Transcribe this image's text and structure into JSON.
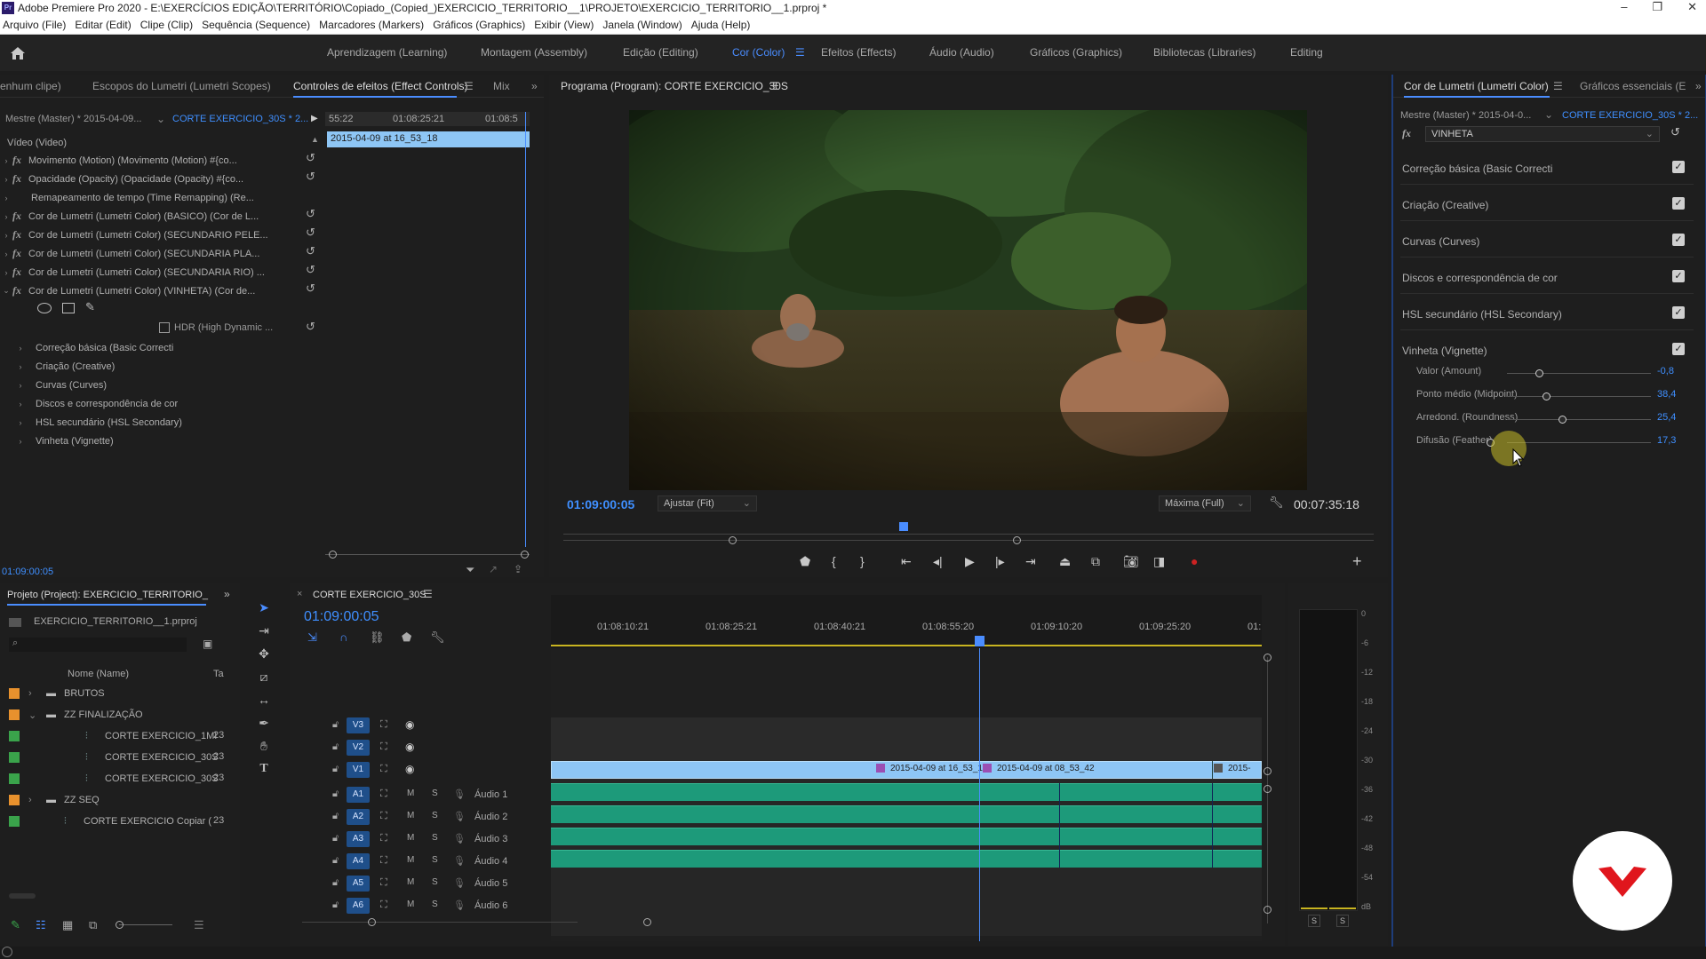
{
  "titlebar": {
    "logo": "Pr",
    "title": "Adobe Premiere Pro 2020 - E:\\EXERCÍCIOS EDIÇÃO\\TERRITÓRIO\\Copiado_(Copied_)EXERCICIO_TERRITORIO__1\\PROJETO\\EXERCICIO_TERRITORIO__1.prproj *",
    "minimize": "–",
    "maximize": "❐",
    "close": "✕"
  },
  "menu": [
    "Arquivo (File)",
    "Editar (Edit)",
    "Clipe (Clip)",
    "Sequência (Sequence)",
    "Marcadores (Markers)",
    "Gráficos (Graphics)",
    "Exibir (View)",
    "Janela (Window)",
    "Ajuda (Help)"
  ],
  "workspaces": {
    "tabs": [
      "Aprendizagem (Learning)",
      "Montagem (Assembly)",
      "Edição (Editing)",
      "Cor (Color)",
      "Efeitos (Effects)",
      "Áudio (Audio)",
      "Gráficos (Graphics)",
      "Bibliotecas (Libraries)",
      "Editing"
    ],
    "active": "Cor (Color)"
  },
  "source_panel": {
    "tabs": [
      "enhum clipe)",
      "Escopos do Lumetri (Lumetri Scopes)",
      "Controles de efeitos (Effect Controls)",
      "Mix"
    ],
    "master_label": "Mestre (Master) * 2015-04-09...",
    "sequence_label": "CORTE EXERCICIO_30S * 2...",
    "ruler": [
      "55:22",
      "01:08:25:21",
      "01:08:5"
    ],
    "clip_name": "2015-04-09 at 16_53_18",
    "video_header": "Vídeo (Video)",
    "effects": [
      "Movimento (Motion)  (Movimento (Motion) #{co...",
      "Opacidade (Opacity)  (Opacidade (Opacity) #{co...",
      "Remapeamento de tempo (Time Remapping)  (Re...",
      "Cor de Lumetri (Lumetri Color) (BASICO)  (Cor de L...",
      "Cor de Lumetri (Lumetri Color) (SECUNDARIO PELE...",
      "Cor de Lumetri (Lumetri Color) (SECUNDARIA PLA...",
      "Cor de Lumetri (Lumetri Color) (SECUNDARIA RIO) ...",
      "Cor de Lumetri (Lumetri Color) (VINHETA)  (Cor de..."
    ],
    "hdr_label": "HDR (High Dynamic ...",
    "sub_sections": [
      "Correção básica (Basic Correcti",
      "Criação (Creative)",
      "Curvas (Curves)",
      "Discos e correspondência de cor",
      "HSL secundário (HSL Secondary)",
      "Vinheta (Vignette)"
    ],
    "timecode": "01:09:00:05"
  },
  "program_monitor": {
    "title": "Programa (Program): CORTE EXERCICIO_30S",
    "timecode": "01:09:00:05",
    "fit": "Ajustar (Fit)",
    "quality": "Máxima (Full)",
    "duration": "00:07:35:18"
  },
  "lumetri": {
    "tabs": [
      "Cor de Lumetri (Lumetri Color)",
      "Gráficos essenciais (E"
    ],
    "master_label": "Mestre (Master) * 2015-04-0...",
    "sequence_label": "CORTE EXERCICIO_30S * 2...",
    "effect_select": "VINHETA",
    "sections": [
      "Correção básica (Basic Correcti",
      "Criação (Creative)",
      "Curvas (Curves)",
      "Discos e correspondência de cor",
      "HSL secundário (HSL Secondary)",
      "Vinheta (Vignette)"
    ],
    "sliders": [
      {
        "label": "Valor (Amount)",
        "value": "-0,8",
        "fraction": 0.52
      },
      {
        "label": "Ponto médio (Midpoint)",
        "value": "38,4",
        "fraction": 0.55
      },
      {
        "label": "Arredond. (Roundness)",
        "value": "25,4",
        "fraction": 0.62
      },
      {
        "label": "Difusão (Feather)",
        "value": "17,3",
        "fraction": 0.31
      }
    ]
  },
  "project": {
    "title": "Projeto (Project): EXERCICIO_TERRITORIO_",
    "file": "EXERCICIO_TERRITORIO__1.prproj",
    "column_name": "Nome (Name)",
    "column_rate": "Ta",
    "items": [
      {
        "name": "BRUTOS",
        "type": "bin",
        "color": "#e8912d",
        "count": ""
      },
      {
        "name": "ZZ FINALIZAÇÃO",
        "type": "bin",
        "color": "#e8912d",
        "count": ""
      },
      {
        "name": "CORTE EXERCICIO_1MI",
        "type": "seq",
        "color": "#3aa34b",
        "count": "23"
      },
      {
        "name": "CORTE EXERCICIO_30S",
        "type": "seq",
        "color": "#3aa34b",
        "count": "23"
      },
      {
        "name": "CORTE EXERCICIO_30S",
        "type": "seq",
        "color": "#3aa34b",
        "count": "23"
      },
      {
        "name": "ZZ SEQ",
        "type": "bin",
        "color": "#e8912d",
        "count": ""
      },
      {
        "name": "CORTE EXERCICIO Copiar (",
        "type": "seq",
        "color": "#3aa34b",
        "count": "23"
      }
    ]
  },
  "timeline": {
    "sequence_tab": "CORTE EXERCICIO_30S",
    "timecode": "01:09:00:05",
    "ruler": [
      "01:08:10:21",
      "01:08:25:21",
      "01:08:40:21",
      "01:08:55:20",
      "01:09:10:20",
      "01:09:25:20",
      "01:"
    ],
    "video_tracks": [
      "V3",
      "V2",
      "V1"
    ],
    "audio_tracks": [
      {
        "id": "A1",
        "name": "Áudio 1"
      },
      {
        "id": "A2",
        "name": "Áudio 2"
      },
      {
        "id": "A3",
        "name": "Áudio 3"
      },
      {
        "id": "A4",
        "name": "Áudio 4"
      },
      {
        "id": "A5",
        "name": "Áudio 5"
      },
      {
        "id": "A6",
        "name": "Áudio 6"
      }
    ],
    "clips": [
      "2015-04-09 at 16_53_1",
      "2015-04-09 at 08_53_42",
      "2015-"
    ]
  },
  "meter": {
    "scale": [
      "0",
      "-6",
      "-12",
      "-18",
      "-24",
      "-30",
      "-36",
      "-42",
      "-48",
      "-54",
      "dB"
    ],
    "solo": "S"
  },
  "colors": {
    "accent": "#3f8fff",
    "clip_video": "#8ec6f5",
    "clip_audio": "#1d9a7a",
    "playhead": "#4a8dff"
  }
}
